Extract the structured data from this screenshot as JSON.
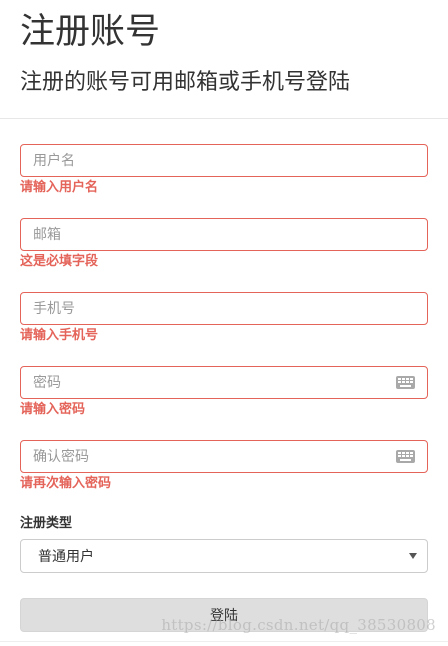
{
  "header": {
    "title": "注册账号",
    "subtitle": "注册的账号可用邮箱或手机号登陆"
  },
  "form": {
    "username": {
      "placeholder": "用户名",
      "value": "",
      "error": "请输入用户名"
    },
    "email": {
      "placeholder": "邮箱",
      "value": "",
      "error": "这是必填字段"
    },
    "phone": {
      "placeholder": "手机号",
      "value": "",
      "error": "请输入手机号"
    },
    "password": {
      "placeholder": "密码",
      "value": "",
      "error": "请输入密码",
      "icon": "keyboard-icon"
    },
    "confirm_password": {
      "placeholder": "确认密码",
      "value": "",
      "error": "请再次输入密码",
      "icon": "keyboard-icon"
    },
    "register_type": {
      "label": "注册类型",
      "selected": "普通用户"
    },
    "submit_label": "登陆"
  },
  "watermark": "https://blog.csdn.net/qq_38530808",
  "colors": {
    "error": "#e4645a",
    "button_bg": "#dedede",
    "text": "#333333"
  }
}
